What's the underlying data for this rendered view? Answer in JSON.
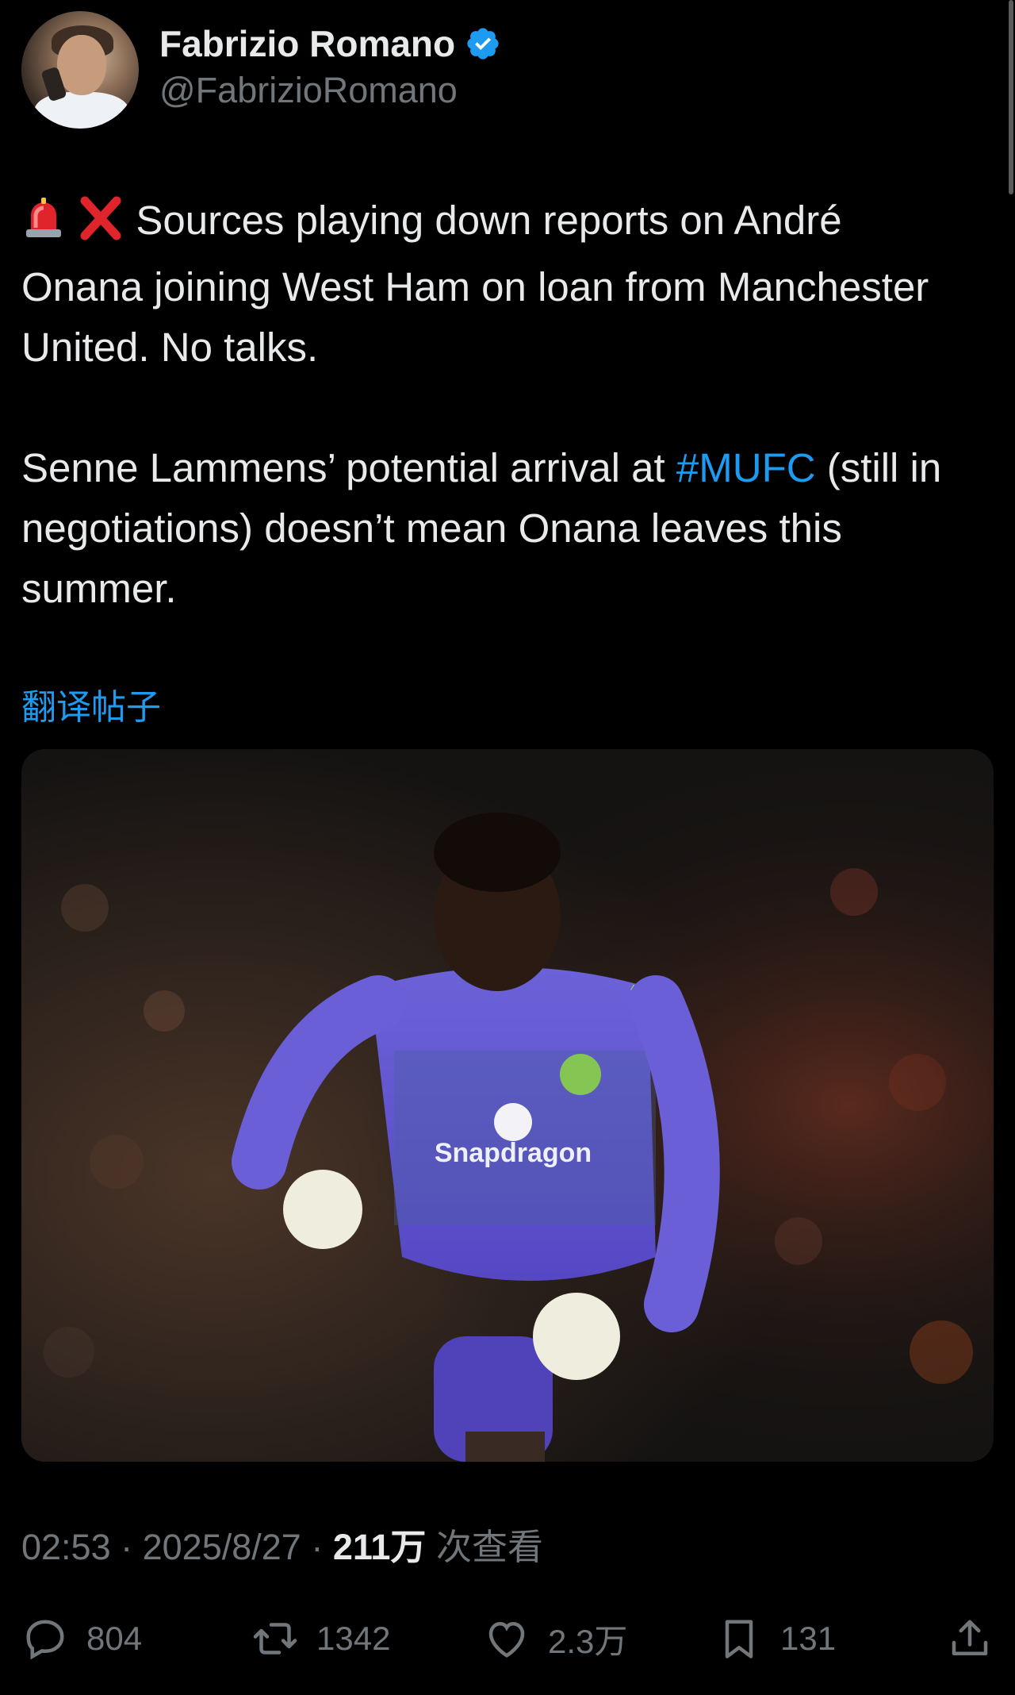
{
  "author": {
    "display_name": "Fabrizio Romano",
    "handle": "@FabrizioRomano",
    "verified": true,
    "avatar_icon": "avatar"
  },
  "tweet": {
    "para1_emojis": [
      "siren-emoji",
      "cross-mark-emoji"
    ],
    "para1_text": "Sources playing down reports on André Onana joining West Ham on loan from Manchester United. No talks.",
    "para2_before": "Senne Lammens’ potential arrival at ",
    "para2_hashtag": "#MUFC",
    "para2_after": " (still in negotiations) doesn’t mean Onana leaves this summer."
  },
  "translate_label": "翻译帖子",
  "media": {
    "jersey_sponsor": "Snapdragon",
    "colors": {
      "kit": "#6a5fd6",
      "accent": "#8fe03a"
    }
  },
  "meta": {
    "time": "02:53",
    "separator1": " · ",
    "date": "2025/8/27",
    "separator2": " · ",
    "views_count": "211万",
    "views_label": " 次查看"
  },
  "actions": {
    "replies": "804",
    "retweets": "1342",
    "likes": "2.3万",
    "bookmarks": "131"
  },
  "colors": {
    "background": "#000000",
    "text": "#e7e9ea",
    "muted": "#71767b",
    "link": "#1d9bf0"
  }
}
